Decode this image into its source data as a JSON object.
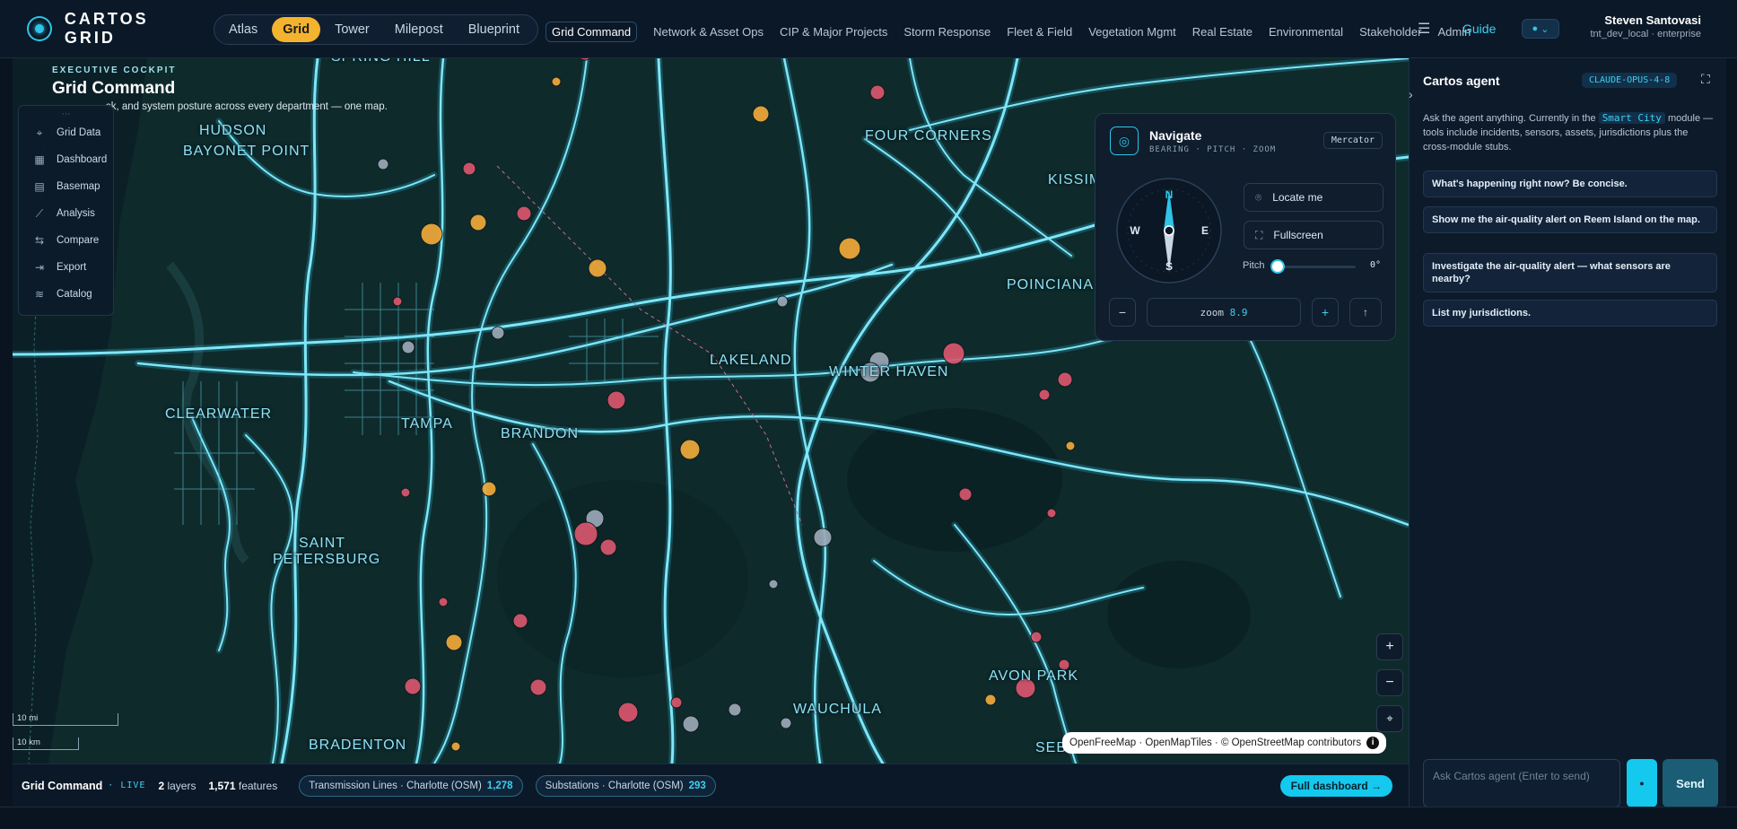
{
  "app": {
    "brand": "CARTOS GRID"
  },
  "topbar": {
    "segments": [
      {
        "label": "Atlas",
        "active": false
      },
      {
        "label": "Grid",
        "active": true
      },
      {
        "label": "Tower",
        "active": false
      },
      {
        "label": "Milepost",
        "active": false
      },
      {
        "label": "Blueprint",
        "active": false
      }
    ],
    "tabs": [
      "Grid Command",
      "Network & Asset Ops",
      "CIP & Major Projects",
      "Storm Response",
      "Fleet & Field",
      "Vegetation Mgmt",
      "Real Estate",
      "Environmental",
      "Stakeholder",
      "Admin"
    ],
    "menu_icon": "hamburger-icon",
    "guide": "Guide",
    "status_dot": "●",
    "user_name": "Steven Santovasi",
    "user_sub": "tnt_dev_local · enterprise"
  },
  "cockpit": {
    "kicker": "EXECUTIVE COCKPIT",
    "title": "Grid Command",
    "subtitle": "sk, and system posture across every department — one map."
  },
  "tools": [
    {
      "label": "Grid Data",
      "icon": "network-icon",
      "glyph": "⌖"
    },
    {
      "label": "Dashboard",
      "icon": "dashboard-icon",
      "glyph": "▦"
    },
    {
      "label": "Basemap",
      "icon": "map-icon",
      "glyph": "▤"
    },
    {
      "label": "Analysis",
      "icon": "chart-icon",
      "glyph": "⟋"
    },
    {
      "label": "Compare",
      "icon": "compare-icon",
      "glyph": "⇆"
    },
    {
      "label": "Export",
      "icon": "export-icon",
      "glyph": "⇥"
    },
    {
      "label": "Catalog",
      "icon": "layers-icon",
      "glyph": "≋"
    }
  ],
  "tools_grip": "⋯",
  "map_labels": [
    "SPRING HILL",
    "HUDSON",
    "BAYONET POINT",
    "FOUR CORNERS",
    "KISSIM",
    "POINCIANA",
    "LAKELAND",
    "WINTER HAVEN",
    "CLEARWATER",
    "TAMPA",
    "BRANDON",
    "SAINT PETERSBURG",
    "AVON PARK",
    "WAUCHULA",
    "BRADENTON",
    "SEB"
  ],
  "navigate": {
    "title": "Navigate",
    "subtitle": "BEARING · PITCH · ZOOM",
    "projection": "Mercator",
    "compass": {
      "n": "N",
      "s": "S",
      "e": "E",
      "w": "W"
    },
    "locate": "Locate me",
    "fullscreen": "Fullscreen",
    "pitch_label": "Pitch",
    "pitch_value": "0°",
    "pitch_fraction": 0,
    "zoom_prefix": "zoom",
    "zoom_value": "8.9",
    "zoom_out": "−",
    "zoom_in": "+",
    "north": "↑"
  },
  "map_controls": {
    "zoom_in": "+",
    "zoom_out": "−",
    "locate": "⌖"
  },
  "scale": {
    "miles": "10 mi",
    "km": "10 km"
  },
  "attribution": {
    "text": "OpenFreeMap · OpenMapTiles · © OpenStreetMap contributors",
    "info": "i"
  },
  "bottom": {
    "title": "Grid Command",
    "live": "LIVE",
    "layers_count": "2",
    "layers_label": "layers",
    "features_count": "1,571",
    "features_label": "features",
    "chips": [
      {
        "label": "Transmission Lines · Charlotte (OSM)",
        "count": "1,278"
      },
      {
        "label": "Substations · Charlotte (OSM)",
        "count": "293"
      }
    ],
    "full_dashboard": "Full dashboard →"
  },
  "agent": {
    "collapse": "›",
    "title": "Cartos agent",
    "model": "CLAUDE-OPUS-4-8",
    "expand": "⛶",
    "desc_pre": "Ask the agent anything. Currently in the",
    "module": "Smart City",
    "desc_post": "module — tools include incidents, sensors, assets, jurisdictions plus the cross-module stubs.",
    "suggestions": [
      "What's happening right now? Be concise.",
      "Show me the air-quality alert on Reem Island on the map.",
      "Investigate the air-quality alert — what sensors are nearby?",
      "List my jurisdictions."
    ],
    "input_placeholder": "Ask Cartos agent (Enter to send)",
    "mic": "●",
    "send": "Send"
  },
  "colors": {
    "accent": "#2ec5e8",
    "grid_line": "#7fe6f7",
    "substation_red": "#d9566e",
    "substation_orange": "#f0a83a",
    "substation_gray": "#9ba8b8",
    "active_segment": "#f4b32f"
  }
}
